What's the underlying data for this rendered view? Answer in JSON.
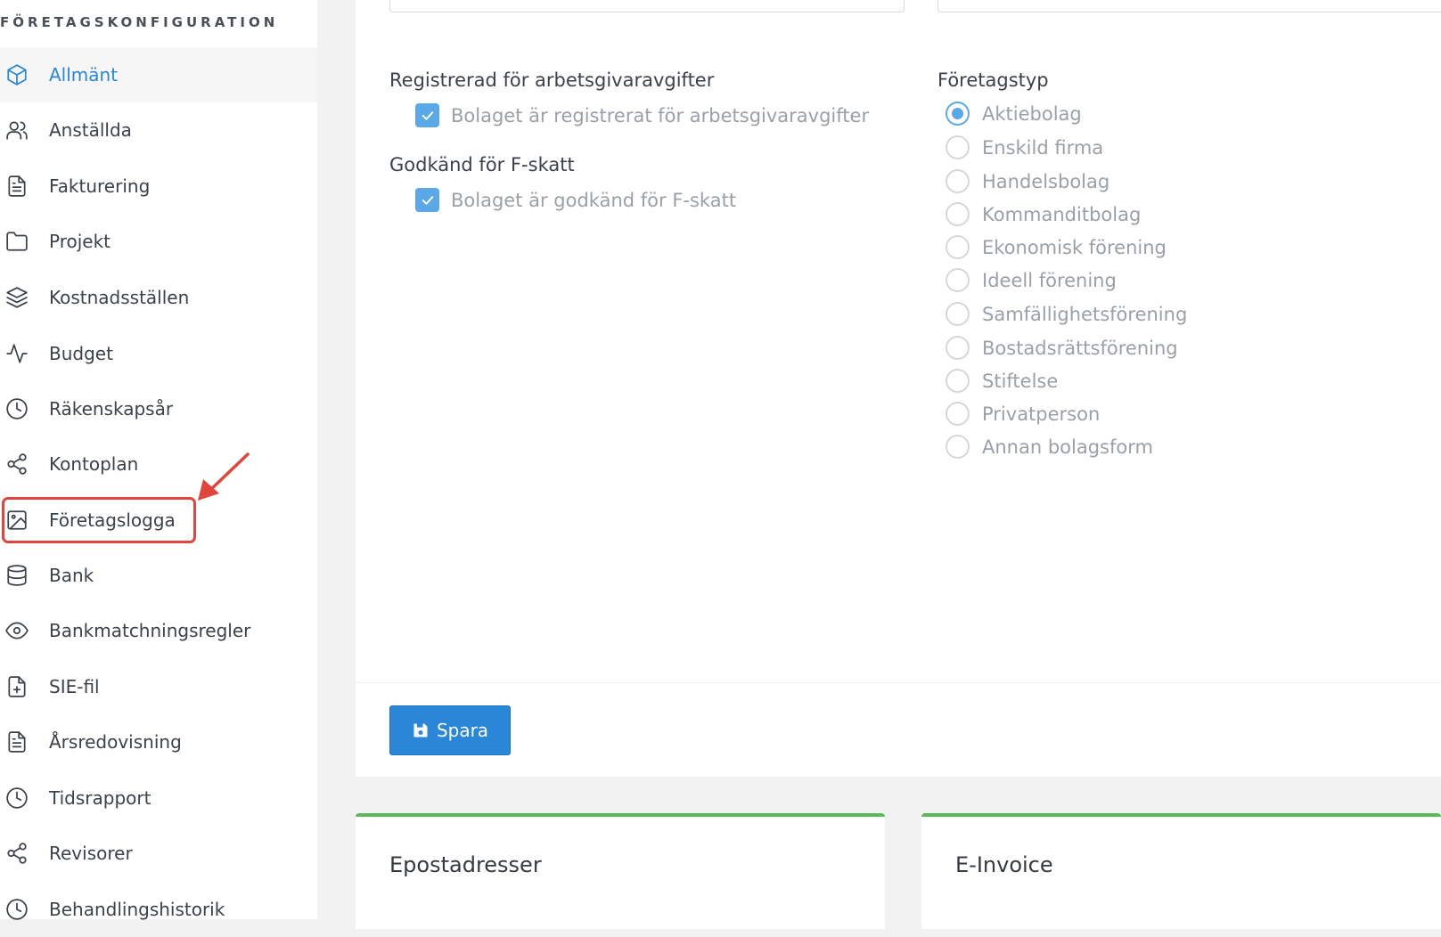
{
  "sidebar": {
    "heading": "FÖRETAGSKONFIGURATION",
    "items": [
      {
        "label": "Allmänt",
        "icon": "cube-icon",
        "active": true
      },
      {
        "label": "Anställda",
        "icon": "users-icon"
      },
      {
        "label": "Fakturering",
        "icon": "file-text-icon"
      },
      {
        "label": "Projekt",
        "icon": "folder-icon"
      },
      {
        "label": "Kostnadsställen",
        "icon": "layers-icon"
      },
      {
        "label": "Budget",
        "icon": "activity-icon"
      },
      {
        "label": "Räkenskapsår",
        "icon": "clock-icon"
      },
      {
        "label": "Kontoplan",
        "icon": "share-icon"
      },
      {
        "label": "Företagslogga",
        "icon": "image-icon",
        "highlighted": true
      },
      {
        "label": "Bank",
        "icon": "database-icon"
      },
      {
        "label": "Bankmatchningsregler",
        "icon": "eye-icon"
      },
      {
        "label": "SIE-fil",
        "icon": "file-plus-icon"
      },
      {
        "label": "Årsredovisning",
        "icon": "file-text-icon"
      },
      {
        "label": "Tidsrapport",
        "icon": "clock-icon"
      },
      {
        "label": "Revisorer",
        "icon": "share-icon"
      },
      {
        "label": "Behandlingshistorik",
        "icon": "clock-icon"
      }
    ]
  },
  "form": {
    "employer_fee": {
      "label": "Registrerad för arbetsgivaravgifter",
      "checkbox_text": "Bolaget är registrerat för arbetsgivaravgifter",
      "checked": true
    },
    "f_tax": {
      "label": "Godkänd för F-skatt",
      "checkbox_text": "Bolaget är godkänd för F-skatt",
      "checked": true
    },
    "company_type": {
      "label": "Företagstyp",
      "selected": "Aktiebolag",
      "options": [
        "Aktiebolag",
        "Enskild firma",
        "Handelsbolag",
        "Kommanditbolag",
        "Ekonomisk förening",
        "Ideell förening",
        "Samfällighetsförening",
        "Bostadsrättsförening",
        "Stiftelse",
        "Privatperson",
        "Annan bolagsform"
      ]
    },
    "save_label": "Spara"
  },
  "cards": {
    "email_title": "Epostadresser",
    "einvoice_title": "E-Invoice"
  },
  "colors": {
    "accent": "#2a86d6",
    "checkbox": "#5aa9e6",
    "highlight": "#e0453b",
    "card_border": "#5cb85c"
  }
}
